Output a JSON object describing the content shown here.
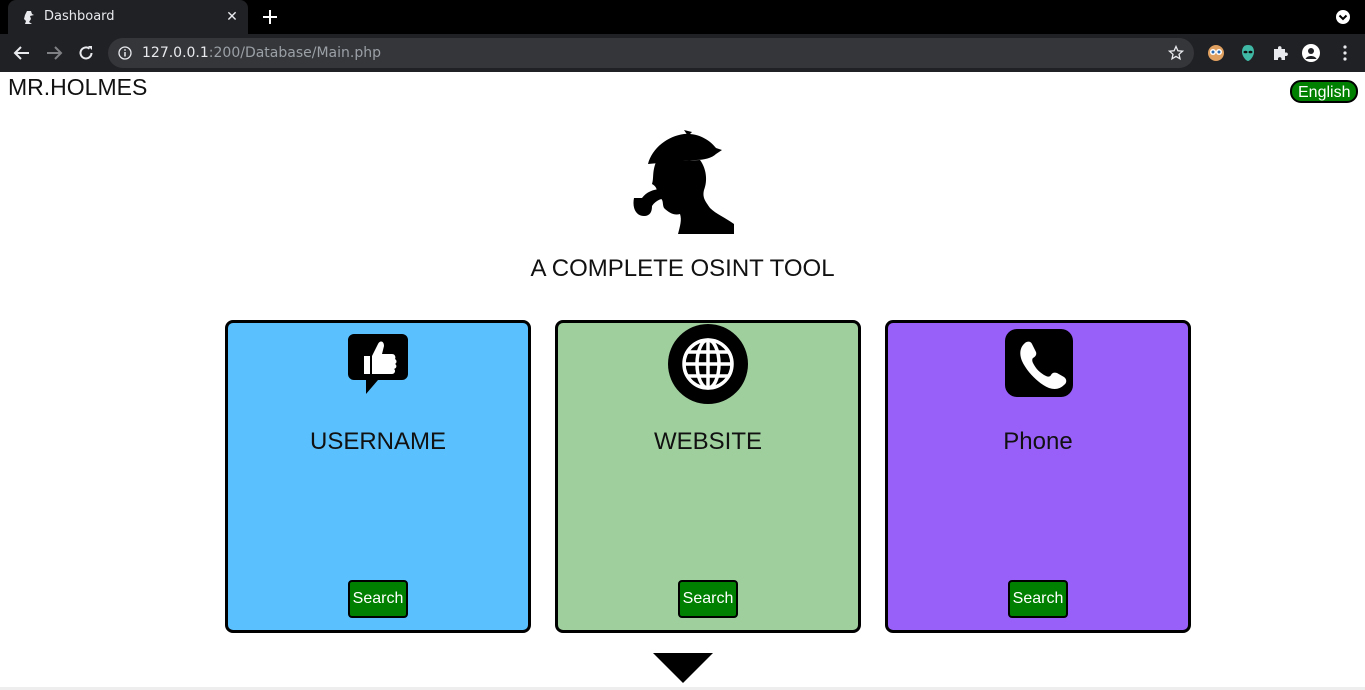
{
  "browser": {
    "tab_title": "Dashboard",
    "tab_close": "✕",
    "url_host": "127.0.0.1",
    "url_path": ":200/Database/Main.php"
  },
  "page": {
    "brand": "MR.HOLMES",
    "language_label": "English",
    "tagline": "A COMPLETE OSINT TOOL",
    "cards": [
      {
        "title": "USERNAME",
        "button": "Search",
        "color": "#5bc0fe",
        "icon": "thumbs-up-chat-icon"
      },
      {
        "title": "WEBSITE",
        "button": "Search",
        "color": "#a0cf9e",
        "icon": "globe-icon"
      },
      {
        "title": "Phone",
        "button": "Search",
        "color": "#995ff9",
        "icon": "phone-icon"
      }
    ]
  },
  "colors": {
    "button_green": "#008000",
    "chrome_dark": "#202124"
  }
}
